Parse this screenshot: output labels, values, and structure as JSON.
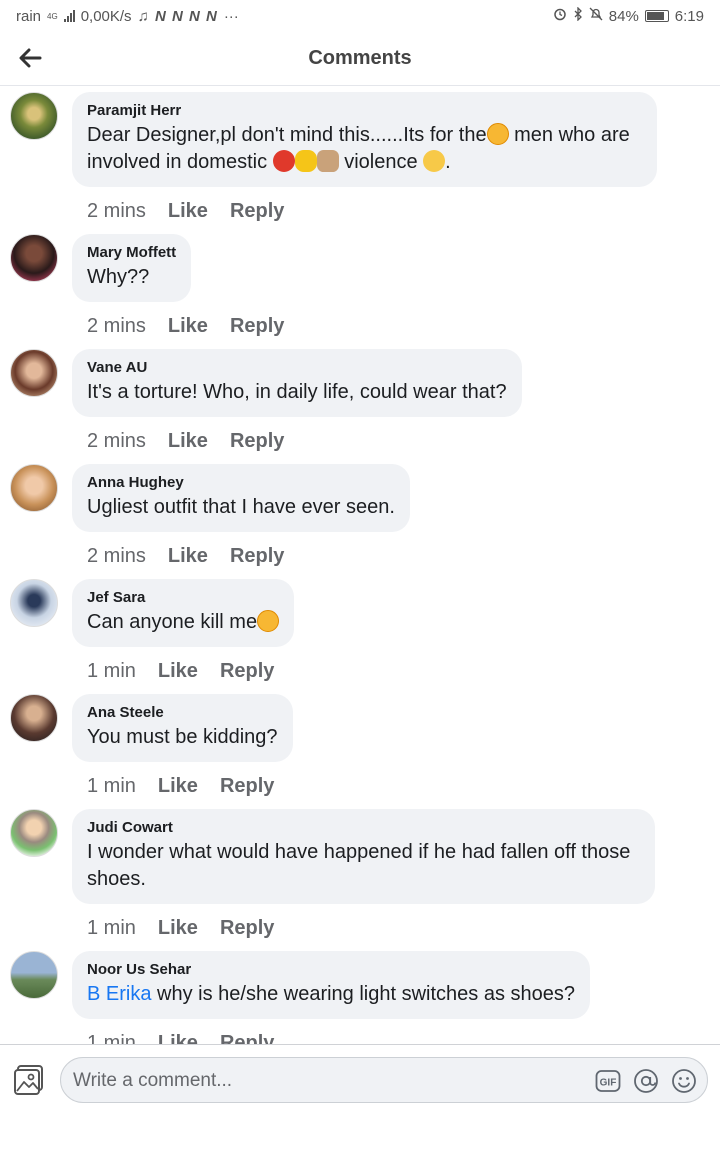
{
  "status_bar": {
    "carrier": "rain",
    "network": "4G",
    "speed": "0,00K/s",
    "notif_glyphs": "♫ N N N N",
    "more": "···",
    "battery": "84%",
    "time": "6:19"
  },
  "header": {
    "title": "Comments"
  },
  "comments": [
    {
      "author": "Paramjit Herr",
      "text_line1": "Dear Designer,pl don't mind this......Its for the",
      "text_line1_end": "men who are",
      "text_line2_start": "involved in domestic",
      "text_line2_mid": "violence",
      "text_line2_end": ".",
      "time": "2 mins",
      "like": "Like",
      "reply": "Reply"
    },
    {
      "author": "Mary Moffett",
      "text": "Why??",
      "time": "2 mins",
      "like": "Like",
      "reply": "Reply"
    },
    {
      "author": "Vane AU",
      "text": "It's a torture! Who, in daily life, could wear that?",
      "time": "2 mins",
      "like": "Like",
      "reply": "Reply"
    },
    {
      "author": "Anna Hughey",
      "text": "Ugliest outfit that I have ever seen.",
      "time": "2 mins",
      "like": "Like",
      "reply": "Reply"
    },
    {
      "author": "Jef Sara",
      "text": "Can anyone kill me",
      "time": "1 min",
      "like": "Like",
      "reply": "Reply"
    },
    {
      "author": "Ana Steele",
      "text": "You must be kidding?",
      "time": "1 min",
      "like": "Like",
      "reply": "Reply"
    },
    {
      "author": "Judi Cowart",
      "text_line1": "I wonder what would have happened if he had fallen off those",
      "text_line2": "shoes.",
      "time": "1 min",
      "like": "Like",
      "reply": "Reply"
    },
    {
      "author": "Noor Us Sehar",
      "mention": "B Erika",
      "text": " why is he/she wearing light switches as shoes?",
      "time": "1 min",
      "like": "Like",
      "reply": "Reply"
    }
  ],
  "composer": {
    "placeholder": "Write a comment..."
  },
  "colors": {
    "bubble": "#f0f2f5",
    "link": "#1877f2",
    "meta": "#65676b"
  }
}
